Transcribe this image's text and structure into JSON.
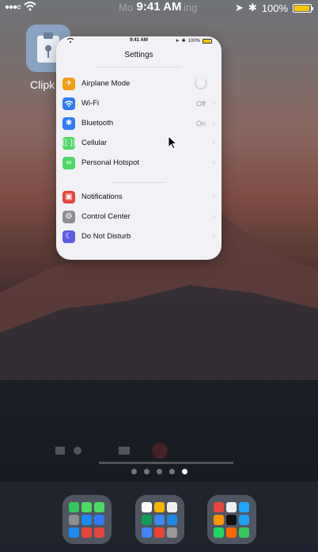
{
  "statusbar": {
    "carrier": "Mo",
    "carrier_tail": "ing",
    "time": "9:41 AM",
    "battery": "100%"
  },
  "home": {
    "app_label": "Clipk"
  },
  "card": {
    "status_time": "9:41 AM",
    "status_battery": "100%",
    "title": "Settings",
    "group1": [
      {
        "label": "Airplane Mode",
        "value": "",
        "icon": "airplane-icon",
        "color": "#f39c12",
        "control": "spinner"
      },
      {
        "label": "Wi-Fi",
        "value": "Off",
        "icon": "wifi-icon",
        "color": "#2f7cf6",
        "control": "chevron"
      },
      {
        "label": "Bluetooth",
        "value": "On",
        "icon": "bluetooth-icon",
        "color": "#2f7cf6",
        "control": "chevron"
      },
      {
        "label": "Cellular",
        "value": "",
        "icon": "cellular-icon",
        "color": "#4cd964",
        "control": "chevron"
      },
      {
        "label": "Personal Hotspot",
        "value": "",
        "icon": "hotspot-icon",
        "color": "#4cd964",
        "control": "chevron"
      }
    ],
    "group2": [
      {
        "label": "Notifications",
        "value": "",
        "icon": "notifications-icon",
        "color": "#e8453c",
        "control": "chevron"
      },
      {
        "label": "Control Center",
        "value": "",
        "icon": "control-center-icon",
        "color": "#8e8e93",
        "control": "chevron"
      },
      {
        "label": "Do Not Disturb",
        "value": "",
        "icon": "moon-icon",
        "color": "#5e5ce6",
        "control": "chevron"
      }
    ]
  },
  "page_dots": {
    "count": 5,
    "active": 4
  },
  "dock": {
    "folders": [
      {
        "icons": [
          "#34c759",
          "#4cd964",
          "#4cd964",
          "#8e8e93",
          "#1c8bf0",
          "#2f7cf6",
          "#1c8bf0",
          "#e8453c",
          "#e8453c"
        ]
      },
      {
        "icons": [
          "#ffffff",
          "#f4b400",
          "#f0f0f0",
          "#0f9d58",
          "#4285f4",
          "#1e88e5",
          "#4285f4",
          "#ea4335",
          "#999999"
        ]
      },
      {
        "icons": [
          "#e8453c",
          "#f0f0f0",
          "#1ea7fd",
          "#ff9500",
          "#111111",
          "#1da1f2",
          "#1ed760",
          "#ff6600",
          "#34c759"
        ]
      }
    ]
  },
  "colors": {
    "accent_yellow": "#f7c600",
    "card_bg": "#f2f2f6"
  }
}
